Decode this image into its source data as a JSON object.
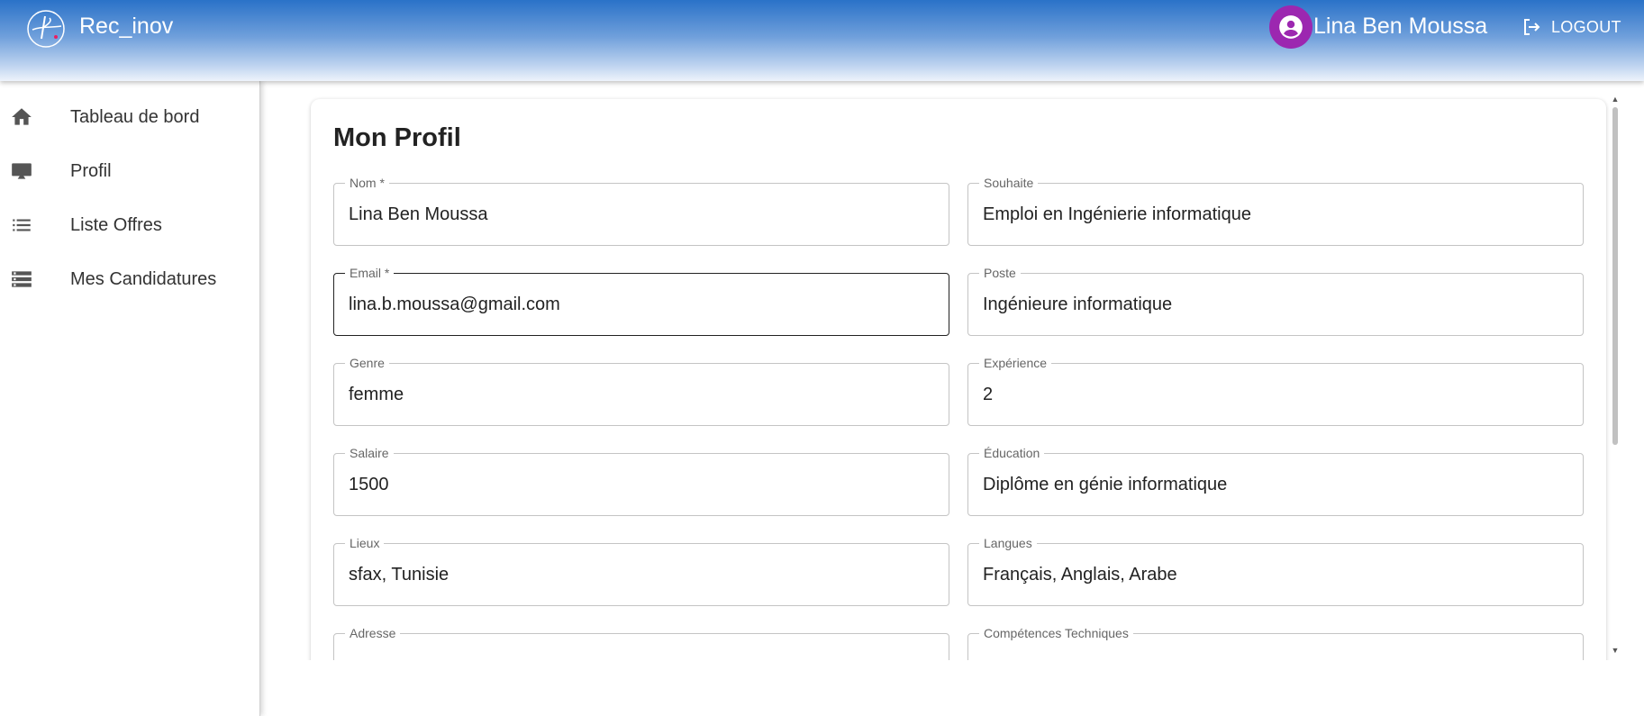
{
  "header": {
    "app_title": "Rec_inov",
    "user_name": "Lina Ben Moussa",
    "logout_label": "LOGOUT"
  },
  "sidebar": {
    "items": [
      {
        "label": "Tableau de bord",
        "icon": "home-icon"
      },
      {
        "label": "Profil",
        "icon": "monitor-icon"
      },
      {
        "label": "Liste Offres",
        "icon": "list-icon"
      },
      {
        "label": "Mes Candidatures",
        "icon": "storage-list-icon"
      }
    ]
  },
  "profile": {
    "title": "Mon Profil",
    "fields": {
      "nom": {
        "label": "Nom *",
        "value": "Lina Ben Moussa"
      },
      "souhaite": {
        "label": "Souhaite",
        "value": "Emploi en Ingénierie informatique"
      },
      "email": {
        "label": "Email *",
        "value": "lina.b.moussa@gmail.com"
      },
      "poste": {
        "label": "Poste",
        "value": "Ingénieure informatique"
      },
      "genre": {
        "label": "Genre",
        "value": "femme"
      },
      "experience": {
        "label": "Expérience",
        "value": "2"
      },
      "salaire": {
        "label": "Salaire",
        "value": "1500"
      },
      "education": {
        "label": "Éducation",
        "value": "Diplôme en génie informatique"
      },
      "lieux": {
        "label": "Lieux",
        "value": "sfax, Tunisie"
      },
      "langues": {
        "label": "Langues",
        "value": "Français, Anglais, Arabe"
      },
      "adresse": {
        "label": "Adresse",
        "value": ""
      },
      "competences": {
        "label": "Compétences Techniques",
        "value": ""
      }
    }
  },
  "colors": {
    "header_gradient_top": "#2a72c8",
    "avatar": "#9c27b0",
    "sidebar_icon": "#555555"
  }
}
